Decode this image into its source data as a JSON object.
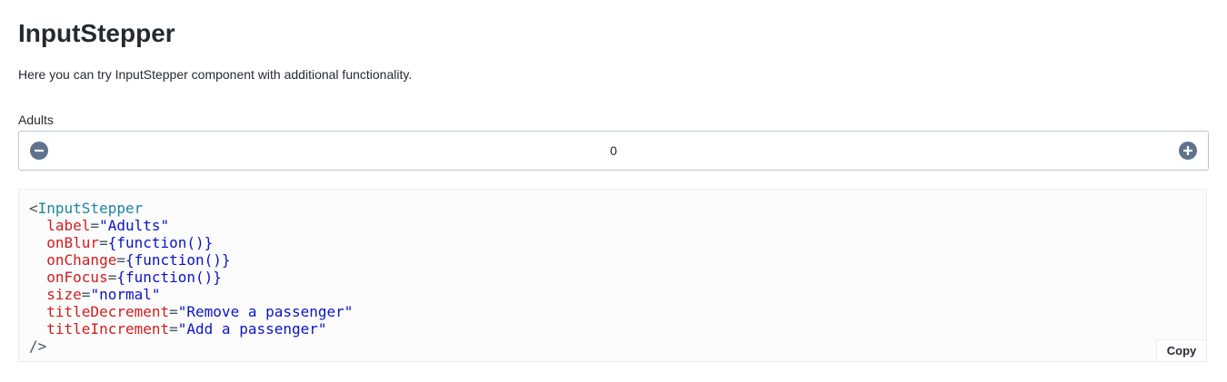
{
  "page": {
    "title": "InputStepper",
    "description": "Here you can try InputStepper component with additional functionality."
  },
  "stepper": {
    "label": "Adults",
    "value": "0",
    "decrement_icon": "minus-circle-icon",
    "increment_icon": "plus-circle-icon",
    "icon_color": "#5f738c",
    "border_color": "#bac7d5"
  },
  "code": {
    "open_bracket": "<",
    "tag": "InputStepper",
    "props": [
      {
        "name": "label",
        "value": "\"Adults\""
      },
      {
        "name": "onBlur",
        "value": "{function()}"
      },
      {
        "name": "onChange",
        "value": "{function()}"
      },
      {
        "name": "onFocus",
        "value": "{function()}"
      },
      {
        "name": "size",
        "value": "\"normal\""
      },
      {
        "name": "titleDecrement",
        "value": "\"Remove a passenger\""
      },
      {
        "name": "titleIncrement",
        "value": "\"Add a passenger\""
      }
    ],
    "close": "/>",
    "copy_label": "Copy",
    "tag_color": "#1b86a0",
    "attr_color": "#d21c1c",
    "string_color": "#0a14c8"
  }
}
